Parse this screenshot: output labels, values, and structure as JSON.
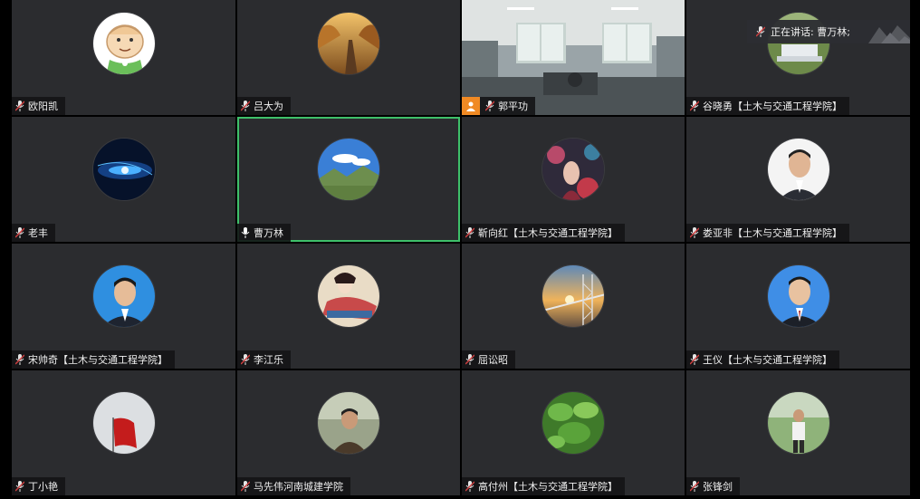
{
  "speaking": {
    "label": "正在讲话: 曹万林;"
  },
  "participants": [
    {
      "name": "欧阳凯",
      "avatar": "cartoon-baby-avatar"
    },
    {
      "name": "吕大为",
      "avatar": "autumn-road-avatar"
    },
    {
      "name": "郭平功",
      "avatar": "office-video",
      "host": true
    },
    {
      "name": "谷晓勇【土木与交通工程学院】",
      "avatar": "laptop-avatar"
    },
    {
      "name": "老丰",
      "avatar": "blue-sphere-avatar"
    },
    {
      "name": "曹万林",
      "avatar": "mountain-sky-avatar",
      "speaking": true
    },
    {
      "name": "靳向红【土木与交通工程学院】",
      "avatar": "floral-portrait-avatar"
    },
    {
      "name": "娄亚非【土木与交通工程学院】",
      "avatar": "man-portrait-avatar"
    },
    {
      "name": "宋帅奇【土木与交通工程学院】",
      "avatar": "man-blue-bg-avatar"
    },
    {
      "name": "李江乐",
      "avatar": "classical-painting-avatar"
    },
    {
      "name": "屈讼昭",
      "avatar": "sunset-steel-avatar"
    },
    {
      "name": "王仪【土木与交通工程学院】",
      "avatar": "man-suit-avatar"
    },
    {
      "name": "丁小艳",
      "avatar": "red-flag-avatar"
    },
    {
      "name": "马先伟河南城建学院",
      "avatar": "man-outdoor-avatar"
    },
    {
      "name": "高付州【土木与交通工程学院】",
      "avatar": "green-leaves-avatar"
    },
    {
      "name": "张锋剑",
      "avatar": "man-park-avatar"
    }
  ],
  "colors": {
    "tile_bg": "#2b2c2f",
    "active_border": "#3ec06a",
    "host_badge": "#f08a24",
    "mic_muted": "#d04040"
  }
}
